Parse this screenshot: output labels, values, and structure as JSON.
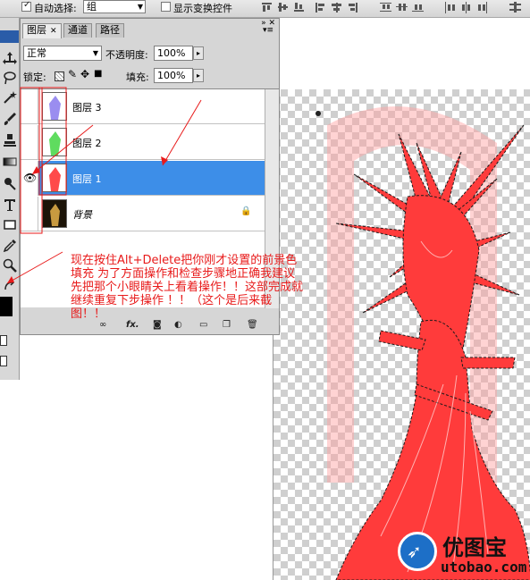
{
  "options_bar": {
    "auto_select_label": "自动选择:",
    "auto_select_value": "组",
    "show_transform_label": "显示变换控件"
  },
  "layers_panel": {
    "tabs": [
      {
        "label": "图层",
        "active": true
      },
      {
        "label": "通道",
        "active": false
      },
      {
        "label": "路径",
        "active": false
      }
    ],
    "blend_mode": "正常",
    "opacity_label": "不透明度:",
    "opacity_value": "100%",
    "lock_label": "锁定:",
    "fill_label": "填充:",
    "fill_value": "100%",
    "layers": [
      {
        "name": "图层 3",
        "visible": false,
        "selected": false,
        "thumb_color": "#9a8df0"
      },
      {
        "name": "图层 2",
        "visible": false,
        "selected": false,
        "thumb_color": "#5fdc5f"
      },
      {
        "name": "图层 1",
        "visible": true,
        "selected": true,
        "thumb_color": "#ff4a4a"
      },
      {
        "name": "背景",
        "visible": false,
        "selected": false,
        "thumb_color": "#3b2a10",
        "locked": true
      }
    ],
    "bottom_icons": [
      "link-icon",
      "fx-icon",
      "mask-icon",
      "adjustment-icon",
      "group-icon",
      "new-layer-icon",
      "trash-icon"
    ]
  },
  "annotation_text": "现在按住Alt+Delete把你刚才设置的前景色填充 为了方面操作和检查步骤地正确我建议先把那个小眼睛关上看着操作！！这部完成就继续重复下步操作 ！！（这个是后来截图！！",
  "watermark": {
    "cn": "优图宝",
    "url": "utobao.com"
  },
  "colors": {
    "selection_blue": "#3d8ee8",
    "annotation_red": "#e81a1a",
    "artwork_red": "#ff3333"
  }
}
